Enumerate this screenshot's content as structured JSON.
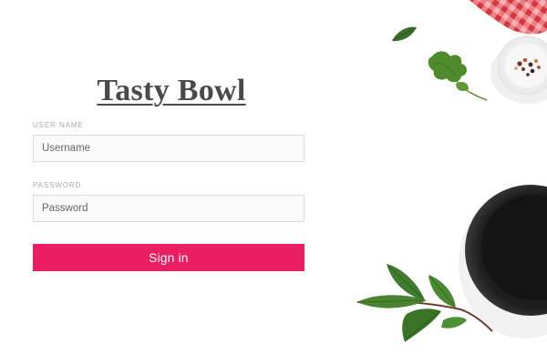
{
  "brand": {
    "title": "Tasty Bowl"
  },
  "login": {
    "username_label": "USER NAME",
    "username_placeholder": "Username",
    "username_value": "",
    "password_label": "PASSWORD",
    "password_placeholder": "Password",
    "password_value": "",
    "signin_label": "Sign in"
  },
  "colors": {
    "accent": "#e91e63",
    "title_text": "#4a4a4a",
    "label_text": "#a9a9a9",
    "field_border": "#dcdcdc",
    "tablecloth_red": "#d9333c",
    "bowl_dark": "#1e1e1e",
    "leaf_green": "#3f7d2c"
  },
  "decorations": [
    "checkered-tablecloth",
    "spice-bowl",
    "parsley-sprig",
    "single-leaf",
    "black-bowl",
    "bay-leaf-branch"
  ]
}
